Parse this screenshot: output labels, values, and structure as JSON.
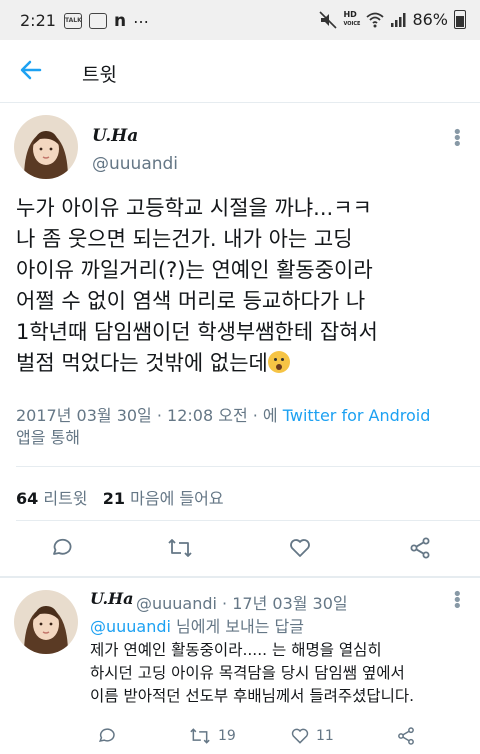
{
  "status": {
    "time": "2:21",
    "battery": "86%",
    "hd_label": "HD",
    "voice_label": "VOICE",
    "talk_label": "TALK",
    "n_label": "n",
    "dots": "⋯"
  },
  "header": {
    "title": "트윗"
  },
  "tweet": {
    "name": "U.Ha",
    "handle": "@uuuandi",
    "lines": [
      "누가 아이유 고등학교 시절을 까냐...ㅋㅋ",
      "나 좀 웃으면 되는건가. 내가 아는 고딩",
      "아이유 까일거리(?)는 연예인 활동중이라",
      "어쩔 수 없이 염색 머리로 등교하다가 나",
      "1학년때 담임쌤이던 학생부쌤한테 잡혀서",
      "벌점 먹었다는 것밖에 없는데"
    ],
    "emoji": "hushed-face",
    "date": "2017년 03월 30일 · 12:08 오전 · 에",
    "source": "Twitter for Android",
    "via": "앱을 통해",
    "retweets": "64",
    "retweets_label": "리트윗",
    "likes": "21",
    "likes_label": "마음에 들어요"
  },
  "reply": {
    "name": "U.Ha",
    "handle_date": "@uuuandi · 17년 03월 30일",
    "mention": "@uuuandi",
    "reply_to_suffix": " 님에게 보내는 답글",
    "lines": [
      "제가 연예인 활동중이라..... 는 해명을 열심히",
      "하시던 고딩 아이유 목격담을 당시 담임쌤 옆에서",
      "이름 받아적던 선도부 후배님께서 들려주셨답니다."
    ],
    "retweet_count": "19",
    "like_count": "11"
  },
  "colors": {
    "accent": "#1da1f2",
    "secondary_text": "#657786",
    "divider": "#e6ecf0"
  }
}
